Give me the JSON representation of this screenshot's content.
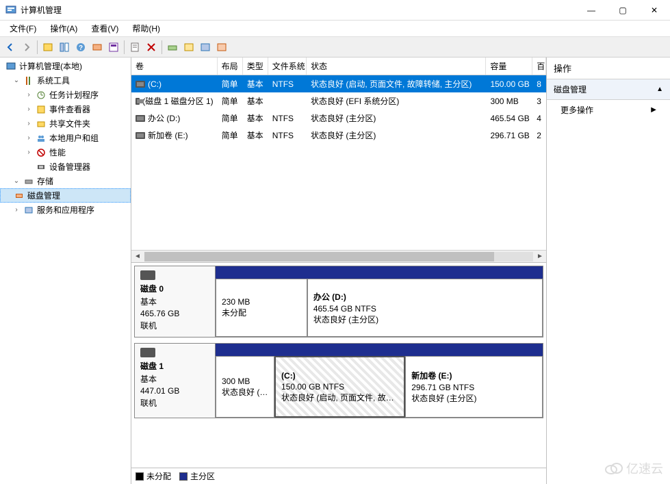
{
  "window": {
    "title": "计算机管理"
  },
  "window_controls": {
    "minimize": "—",
    "maximize": "▢",
    "close": "✕"
  },
  "menu": {
    "file": "文件(F)",
    "action": "操作(A)",
    "view": "查看(V)",
    "help": "帮助(H)"
  },
  "tree": {
    "root": "计算机管理(本地)",
    "system_tools": "系统工具",
    "task_scheduler": "任务计划程序",
    "event_viewer": "事件查看器",
    "shared_folders": "共享文件夹",
    "local_users": "本地用户和组",
    "performance": "性能",
    "device_manager": "设备管理器",
    "storage": "存储",
    "disk_mgmt": "磁盘管理",
    "services_apps": "服务和应用程序"
  },
  "volumes": {
    "headers": {
      "vol": "卷",
      "layout": "布局",
      "type": "类型",
      "fs": "文件系统",
      "status": "状态",
      "capacity": "容量",
      "free": "百"
    },
    "rows": [
      {
        "name": "(C:)",
        "layout": "简单",
        "type": "基本",
        "fs": "NTFS",
        "status": "状态良好 (启动, 页面文件, 故障转储, 主分区)",
        "capacity": "150.00 GB",
        "free": "8"
      },
      {
        "name": "(磁盘 1 磁盘分区 1)",
        "layout": "简单",
        "type": "基本",
        "fs": "",
        "status": "状态良好 (EFI 系统分区)",
        "capacity": "300 MB",
        "free": "3"
      },
      {
        "name": "办公 (D:)",
        "layout": "简单",
        "type": "基本",
        "fs": "NTFS",
        "status": "状态良好 (主分区)",
        "capacity": "465.54 GB",
        "free": "4"
      },
      {
        "name": "新加卷 (E:)",
        "layout": "简单",
        "type": "基本",
        "fs": "NTFS",
        "status": "状态良好 (主分区)",
        "capacity": "296.71 GB",
        "free": "2"
      }
    ]
  },
  "disks": {
    "disk0": {
      "name": "磁盘 0",
      "type": "基本",
      "size": "465.76 GB",
      "status": "联机",
      "parts": [
        {
          "title": "",
          "line1": "230 MB",
          "line2": "未分配"
        },
        {
          "title": "办公  (D:)",
          "line1": "465.54 GB NTFS",
          "line2": "状态良好 (主分区)"
        }
      ]
    },
    "disk1": {
      "name": "磁盘 1",
      "type": "基本",
      "size": "447.01 GB",
      "status": "联机",
      "parts": [
        {
          "title": "",
          "line1": "300 MB",
          "line2": "状态良好 (EFI"
        },
        {
          "title": "(C:)",
          "line1": "150.00 GB NTFS",
          "line2": "状态良好 (启动, 页面文件, 故障转"
        },
        {
          "title": "新加卷  (E:)",
          "line1": "296.71 GB NTFS",
          "line2": "状态良好 (主分区)"
        }
      ]
    }
  },
  "legend": {
    "unallocated": "未分配",
    "primary": "主分区"
  },
  "actions": {
    "header": "操作",
    "disk_mgmt": "磁盘管理",
    "more": "更多操作"
  },
  "watermark": "亿速云"
}
